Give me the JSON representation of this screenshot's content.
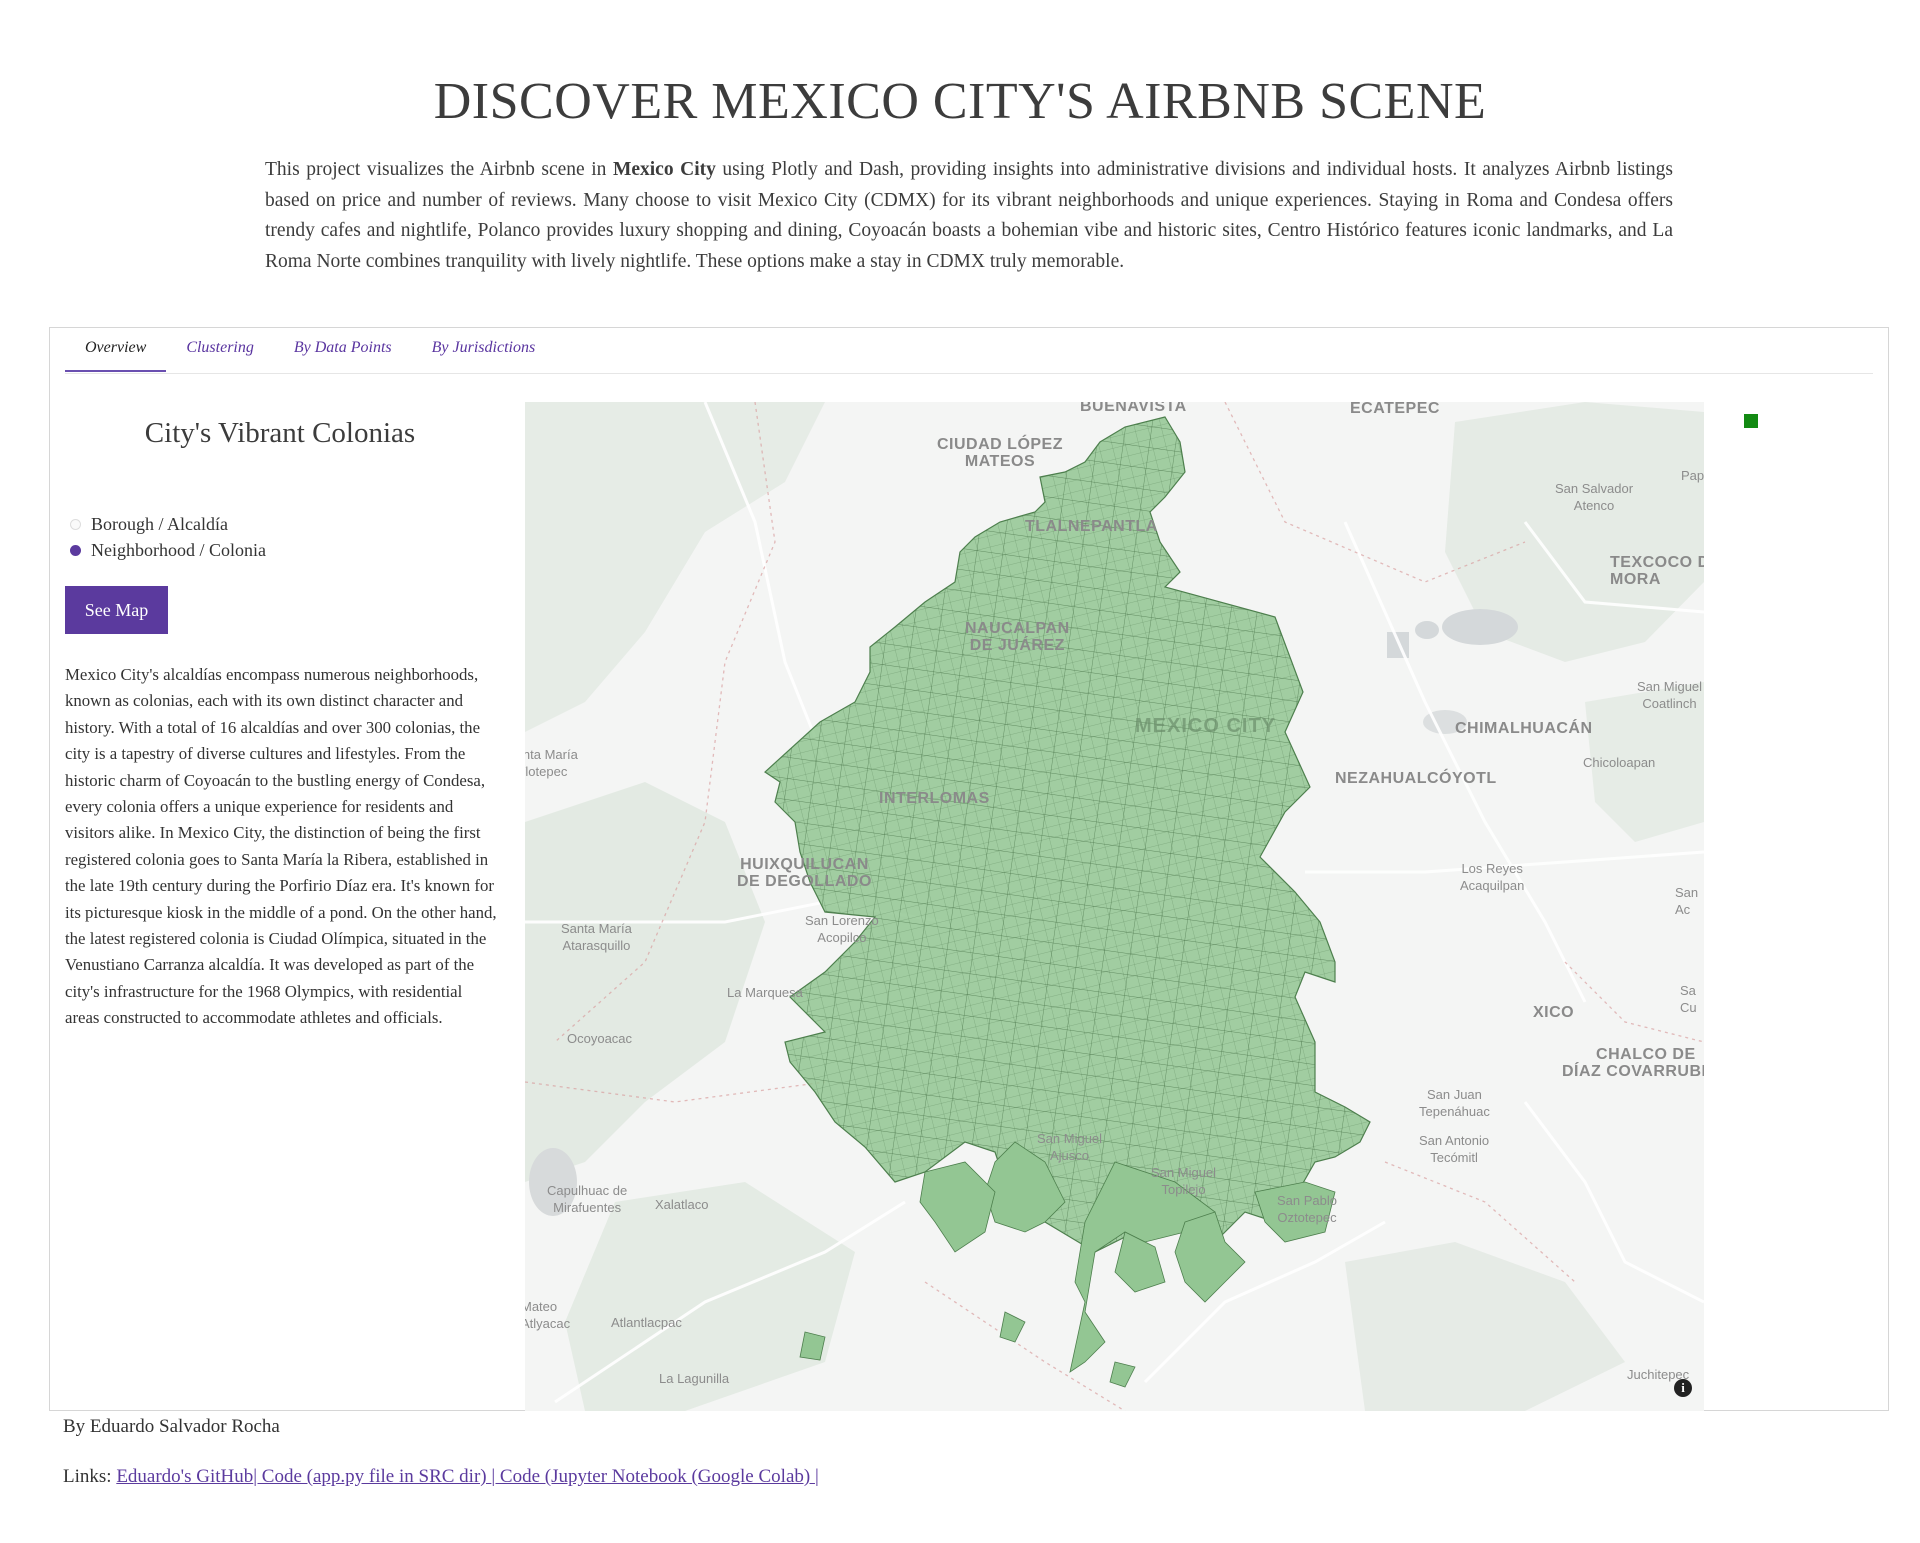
{
  "header": {
    "title": "DISCOVER MEXICO CITY'S AIRBNB SCENE",
    "intro_before": "This project visualizes the Airbnb scene in ",
    "intro_bold": "Mexico City",
    "intro_after": " using Plotly and Dash, providing insights into administrative divisions and individual hosts. It analyzes Airbnb listings based on price and number of reviews. Many choose to visit Mexico City (CDMX) for its vibrant neighborhoods and unique experiences. Staying in Roma and Condesa offers trendy cafes and nightlife, Polanco provides luxury shopping and dining, Coyoacán boasts a bohemian vibe and historic sites, Centro Histórico features iconic landmarks, and La Roma Norte combines tranquility with lively nightlife. These options make a stay in CDMX truly memorable."
  },
  "tabs": [
    {
      "label": "Overview",
      "active": true
    },
    {
      "label": "Clustering",
      "active": false
    },
    {
      "label": "By Data Points",
      "active": false
    },
    {
      "label": "By Jurisdictions",
      "active": false
    }
  ],
  "panel": {
    "heading": "City's Vibrant Colonias",
    "radio_options": [
      {
        "label": "Borough / Alcaldía",
        "selected": false
      },
      {
        "label": "Neighborhood / Colonia",
        "selected": true
      }
    ],
    "button_label": "See Map",
    "description": "Mexico City's alcaldías encompass numerous neighborhoods, known as colonias, each with its own distinct character and history. With a total of 16 alcaldías and over 300 colonias, the city is a tapestry of diverse cultures and lifestyles. From the historic charm of Coyoacán to the bustling energy of Condesa, every colonia offers a unique experience for residents and visitors alike. In Mexico City, the distinction of being the first registered colonia goes to Santa María la Ribera, established in the late 19th century during the Porfirio Díaz era. It's known for its picturesque kiosk in the middle of a pond. On the other hand, the latest registered colonia is Ciudad Olímpica, situated in the Venustiano Carranza alcaldía. It was developed as part of the city's infrastructure for the 1968 Olympics, with residential areas constructed to accommodate athletes and officials."
  },
  "map": {
    "fill_color": "#8fc58f",
    "legend_color": "#128a12",
    "info_icon": "i",
    "labels": [
      {
        "text": "BUENAVISTA"
      },
      {
        "text": "ECATEPEC"
      },
      {
        "text": "CIUDAD LÓPEZ\nMATEOS"
      },
      {
        "text": "TLALNEPANTLA"
      },
      {
        "text": "NAUCALPAN\nDE JUÁREZ"
      },
      {
        "text": "MEXICO CITY"
      },
      {
        "text": "CHIMALHUACÁN"
      },
      {
        "text": "NEZAHUALCÓYOTL"
      },
      {
        "text": "INTERLOMAS"
      },
      {
        "text": "HUIXQUILUCAN\nDE DEGOLLADO"
      },
      {
        "text": "TEXCOCO DE\nMORA"
      },
      {
        "text": "CHALCO DE\nDÍAZ COVARRUBIAS"
      },
      {
        "text": "XICO"
      },
      {
        "text": "San Salvador\nAtenco"
      },
      {
        "text": "Pap"
      },
      {
        "text": "San Miguel\nCoatlinch"
      },
      {
        "text": "Chicoloapan"
      },
      {
        "text": "Los Reyes\nAcaquilpan"
      },
      {
        "text": "Santa María\nTlotepec"
      },
      {
        "text": "San Lorenzo\nAcopilco"
      },
      {
        "text": "Santa María\nAtarasquillo"
      },
      {
        "text": "La Marquesa"
      },
      {
        "text": "Ocoyoacac"
      },
      {
        "text": "San Miguel\nAjusco"
      },
      {
        "text": "San Miguel\nTopilejo"
      },
      {
        "text": "San Pablo\nOztotepec"
      },
      {
        "text": "San Juan\nTepenáhuac"
      },
      {
        "text": "San Antonio\nTecómitl"
      },
      {
        "text": "Capulhuac de\nMirafuentes"
      },
      {
        "text": "Xalatlaco"
      },
      {
        "text": "Mateo\nAtlyacac"
      },
      {
        "text": "Atlantlacpac"
      },
      {
        "text": "La Lagunilla"
      },
      {
        "text": "Juchitepec"
      },
      {
        "text": "San\nAc"
      },
      {
        "text": "Sa\nCu"
      }
    ]
  },
  "footer": {
    "author": "By Eduardo Salvador Rocha",
    "links_label": "Links: ",
    "links": [
      {
        "text": "Eduardo's GitHub"
      },
      {
        "text": "| Code (app.py file in SRC dir) "
      },
      {
        "text": "| Code (Jupyter Notebook (Google Colab) "
      },
      {
        "text": "|"
      }
    ]
  }
}
